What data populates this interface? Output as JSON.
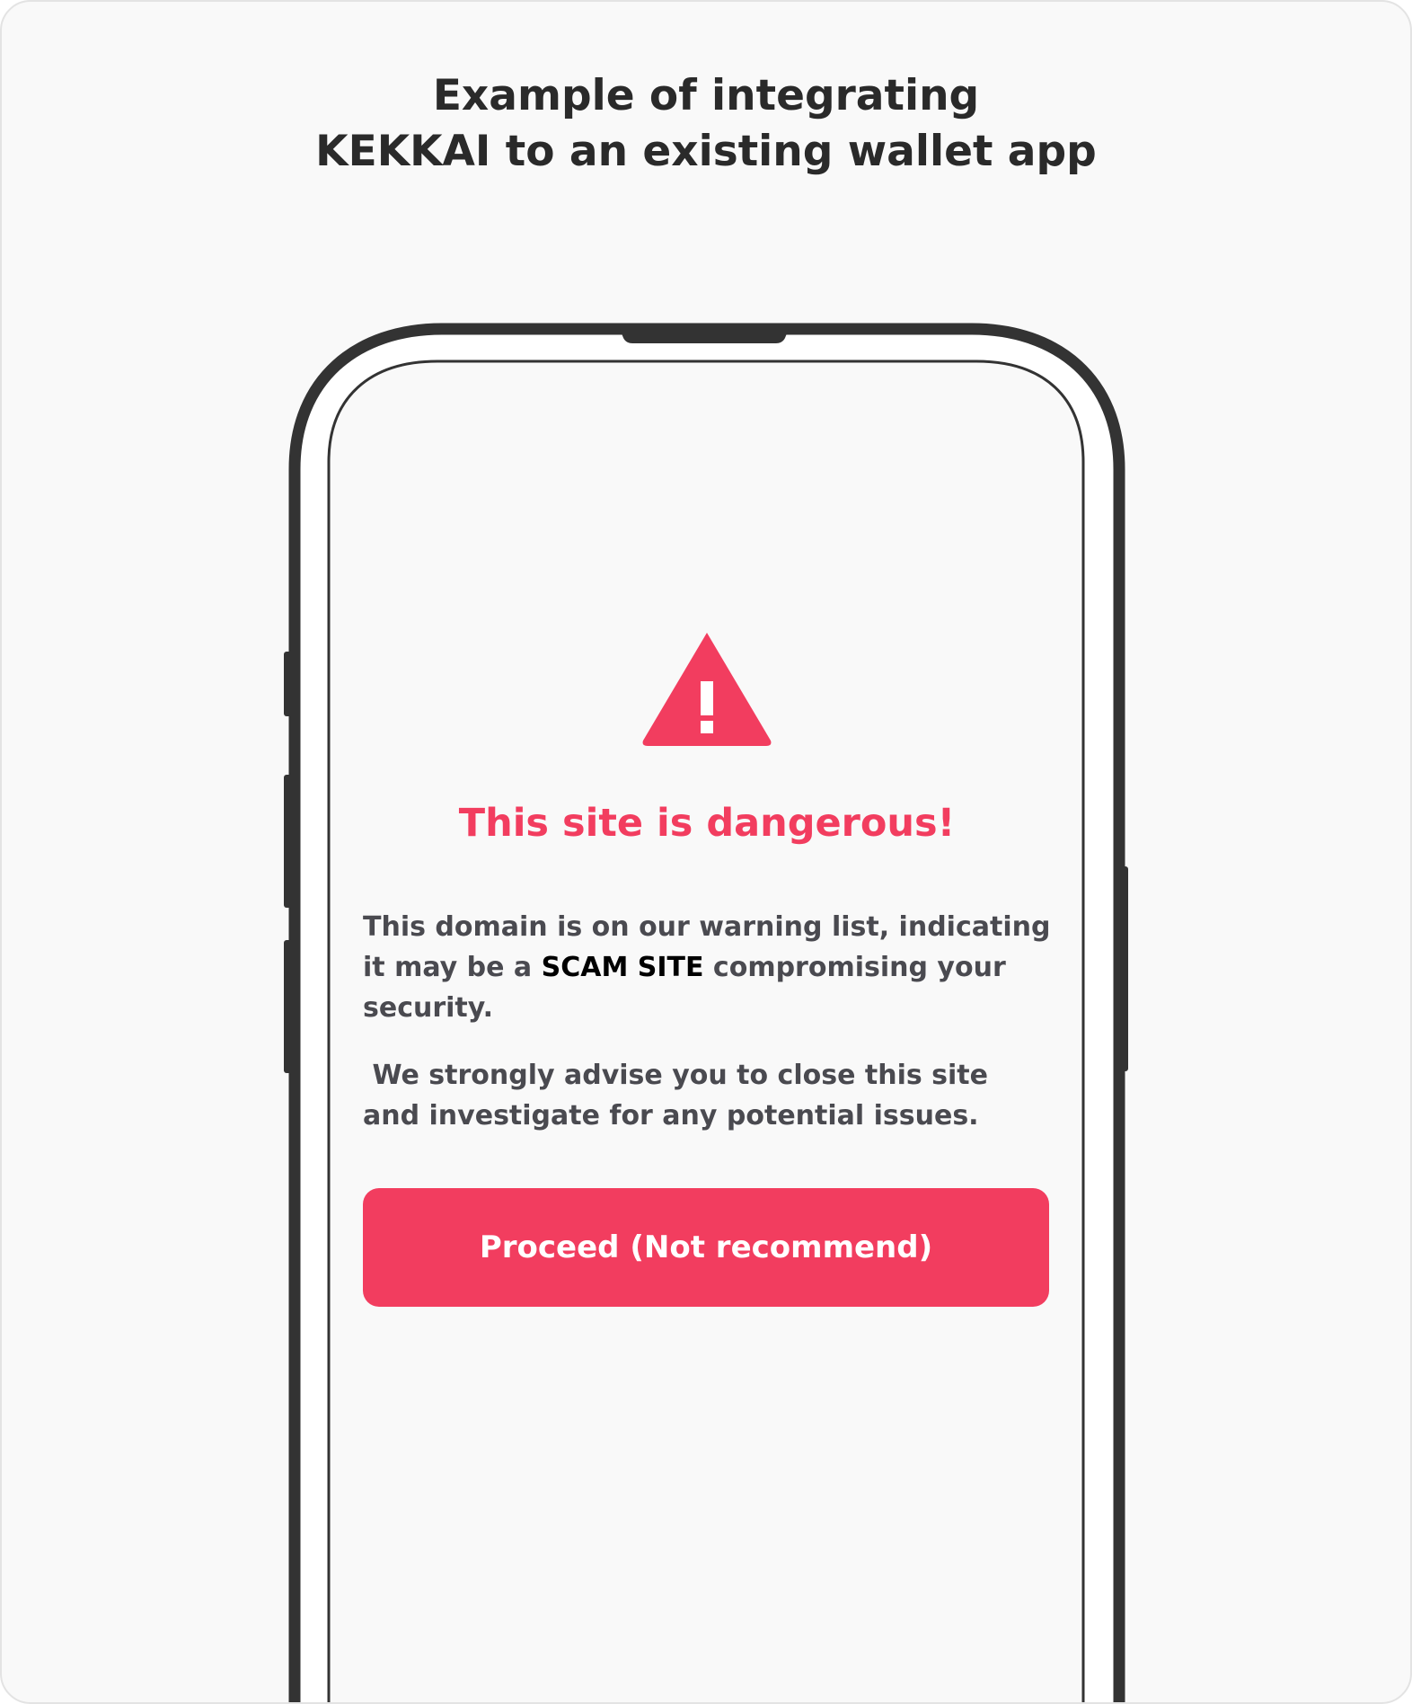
{
  "header": {
    "title_line1": "Example of integrating",
    "title_line2": "KEKKAI to an existing wallet app"
  },
  "warning": {
    "icon": "warning-triangle-icon",
    "headline": "This site is dangerous!",
    "paragraph1_before": "This domain is on our warning list, indicating it may be a ",
    "paragraph1_emphasis": "SCAM SITE",
    "paragraph1_after": " compromising your security.",
    "paragraph2": " We strongly advise you to close this site and investigate for any potential issues.",
    "proceed_label": "Proceed (Not recommend)"
  },
  "colors": {
    "accent": "#f23d5f",
    "background": "#f9f9f9",
    "phone_frame": "#333333",
    "body_text": "#4a4a50"
  }
}
